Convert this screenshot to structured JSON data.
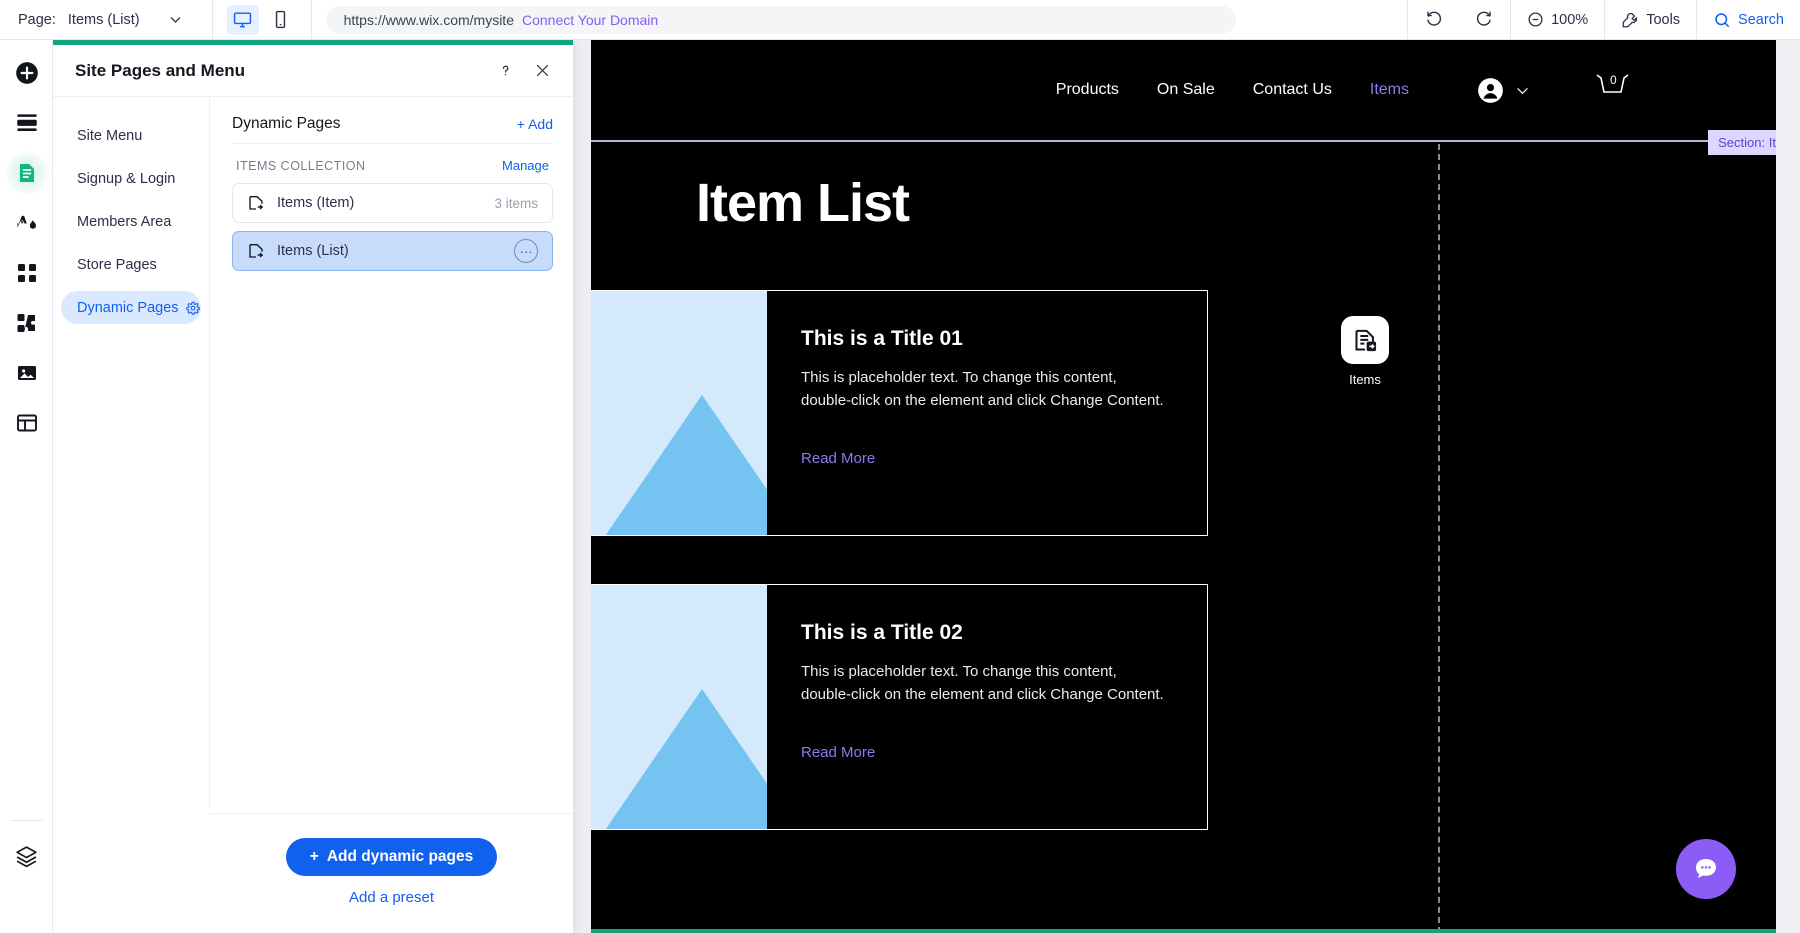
{
  "topbar": {
    "page_label": "Page:",
    "page_value": "Items (List)",
    "caret_icon": "chevron-down-icon",
    "desktop_icon": "desktop-icon",
    "mobile_icon": "mobile-icon",
    "url": "https://www.wix.com/mysite",
    "connect_domain": "Connect Your Domain",
    "undo_icon": "undo-icon",
    "redo_icon": "redo-icon",
    "zoom_label": "100%",
    "zoom_icon": "zoom-out-icon",
    "tools_label": "Tools",
    "tools_icon": "wrench-icon",
    "search_label": "Search",
    "search_icon": "search-icon"
  },
  "rail": {
    "items": [
      {
        "name": "add-elements",
        "icon": "plus-circle-icon",
        "active": false
      },
      {
        "name": "site-sections",
        "icon": "sections-icon",
        "active": false
      },
      {
        "name": "pages-and-menu",
        "icon": "page-document-icon",
        "active": true
      },
      {
        "name": "site-design",
        "icon": "theme-paint-icon",
        "active": false
      },
      {
        "name": "apps",
        "icon": "apps-grid-icon",
        "active": false
      },
      {
        "name": "plugins",
        "icon": "puzzle-icon",
        "active": false
      },
      {
        "name": "media",
        "icon": "image-icon",
        "active": false
      },
      {
        "name": "cms",
        "icon": "table-icon",
        "active": false
      }
    ],
    "bottom": {
      "name": "layers",
      "icon": "layers-icon"
    }
  },
  "panel": {
    "title": "Site Pages and Menu",
    "help_icon": "question-mark-icon",
    "close_icon": "close-icon",
    "accent_color": "#10a37f",
    "nav": [
      {
        "label": "Site Menu",
        "active": false,
        "gear": false
      },
      {
        "label": "Signup & Login",
        "active": false,
        "gear": false
      },
      {
        "label": "Members Area",
        "active": false,
        "gear": false
      },
      {
        "label": "Store Pages",
        "active": false,
        "gear": false
      },
      {
        "label": "Dynamic Pages",
        "active": true,
        "gear": true,
        "gear_icon": "gear-icon"
      }
    ],
    "section_title": "Dynamic Pages",
    "add_label": "+ Add",
    "collection_name": "ITEMS COLLECTION",
    "manage_label": "Manage",
    "pages": [
      {
        "label": "Items (Item)",
        "count": "3 items",
        "selected": false,
        "icon": "dynamic-page-icon"
      },
      {
        "label": "Items (List)",
        "count": "",
        "selected": true,
        "icon": "dynamic-page-icon",
        "more_icon": "more-options-icon"
      }
    ],
    "footer": {
      "primary_label": "Add dynamic pages",
      "primary_icon": "plus-icon",
      "link_label": "Add a preset"
    }
  },
  "canvas": {
    "site_nav": [
      {
        "label": "Products",
        "current": false
      },
      {
        "label": "On Sale",
        "current": false
      },
      {
        "label": "Contact Us",
        "current": false
      },
      {
        "label": "Items",
        "current": true
      }
    ],
    "account_icon": "user-avatar-icon",
    "account_caret_icon": "chevron-down-icon",
    "cart_icon": "shopping-cart-icon",
    "cart_count": "0",
    "tooltip": "Section: Items (List)",
    "hero_title": "Item List",
    "cards": [
      {
        "title": "This is a Title 01",
        "text": "This is placeholder text. To change this content, double-click on the element and click Change Content.",
        "link": "Read More",
        "image_icon": "mountain-placeholder-image"
      },
      {
        "title": "This is a Title 02",
        "text": "This is placeholder text. To change this content, double-click on the element and click Change Content.",
        "link": "Read More",
        "image_icon": "mountain-placeholder-image"
      }
    ],
    "page_badge": {
      "label": "Items",
      "icon": "dynamic-page-icon"
    },
    "chat_icon": "chat-bubble-icon",
    "accent_color": "#8b5cf6"
  }
}
